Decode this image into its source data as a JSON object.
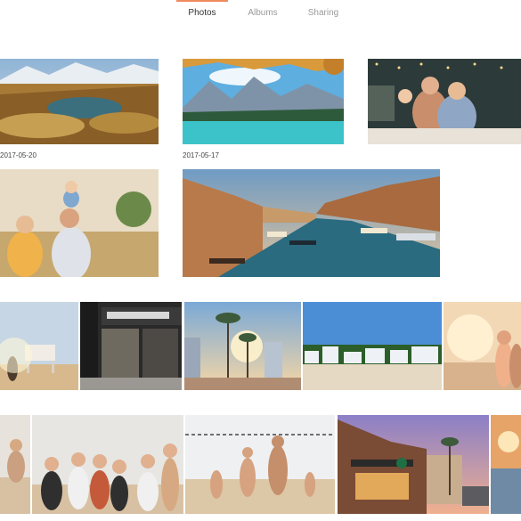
{
  "tabs": [
    {
      "label": "Photos",
      "active": true
    },
    {
      "label": "Albums",
      "active": false
    },
    {
      "label": "Sharing",
      "active": false
    }
  ],
  "accent_color": "#f08a5d",
  "groups": [
    {
      "date": "2017-05-20",
      "photos": [
        "mountain-lake-landscape"
      ]
    },
    {
      "date": "2017-05-17",
      "photos": [
        "alpine-lake-pine-trees",
        "family-dinner-string-lights"
      ]
    }
  ],
  "other_photos": [
    "father-child-on-shoulders",
    "venice-canal-boats",
    "beach-lifeguard-tower",
    "starbucks-storefront",
    "palm-trees-sunset-city",
    "beach-houses-palms",
    "couple-beach-sunset",
    "beach-friends-cheering",
    "beach-volleyball-players",
    "starbucks-building-dusk",
    "sunset-road"
  ]
}
